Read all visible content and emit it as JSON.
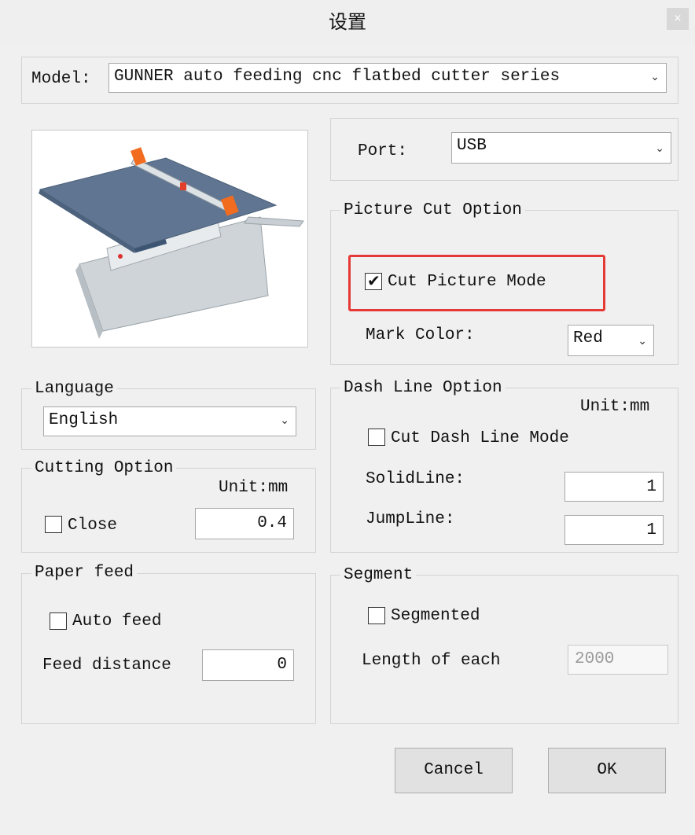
{
  "window": {
    "title": "设置",
    "close_label": "×"
  },
  "model": {
    "label": "Model:",
    "value": "GUNNER auto feeding cnc flatbed cutter series"
  },
  "port": {
    "label": "Port:",
    "value": "USB"
  },
  "picture_cut": {
    "group_label": "Picture Cut Option",
    "cut_picture_mode_label": "Cut Picture Mode",
    "cut_picture_mode_checked": true,
    "mark_color_label": "Mark Color:",
    "mark_color_value": "Red",
    "highlight_color": "#e53935"
  },
  "language": {
    "group_label": "Language",
    "value": "English"
  },
  "cutting_option": {
    "group_label": "Cutting Option",
    "unit": "Unit:mm",
    "close_label": "Close",
    "close_checked": false,
    "value": "0.4"
  },
  "dash_line": {
    "group_label": "Dash Line Option",
    "unit": "Unit:mm",
    "mode_label": "Cut Dash Line Mode",
    "mode_checked": false,
    "solid_label": "SolidLine:",
    "solid_value": "1",
    "jump_label": "JumpLine:",
    "jump_value": "1"
  },
  "paper_feed": {
    "group_label": "Paper feed",
    "auto_feed_label": "Auto feed",
    "auto_feed_checked": false,
    "distance_label": "Feed distance",
    "distance_value": "0"
  },
  "segment": {
    "group_label": "Segment",
    "segmented_label": "Segmented",
    "segmented_checked": false,
    "length_label": "Length of each",
    "length_value": "2000"
  },
  "buttons": {
    "cancel": "Cancel",
    "ok": "OK"
  }
}
